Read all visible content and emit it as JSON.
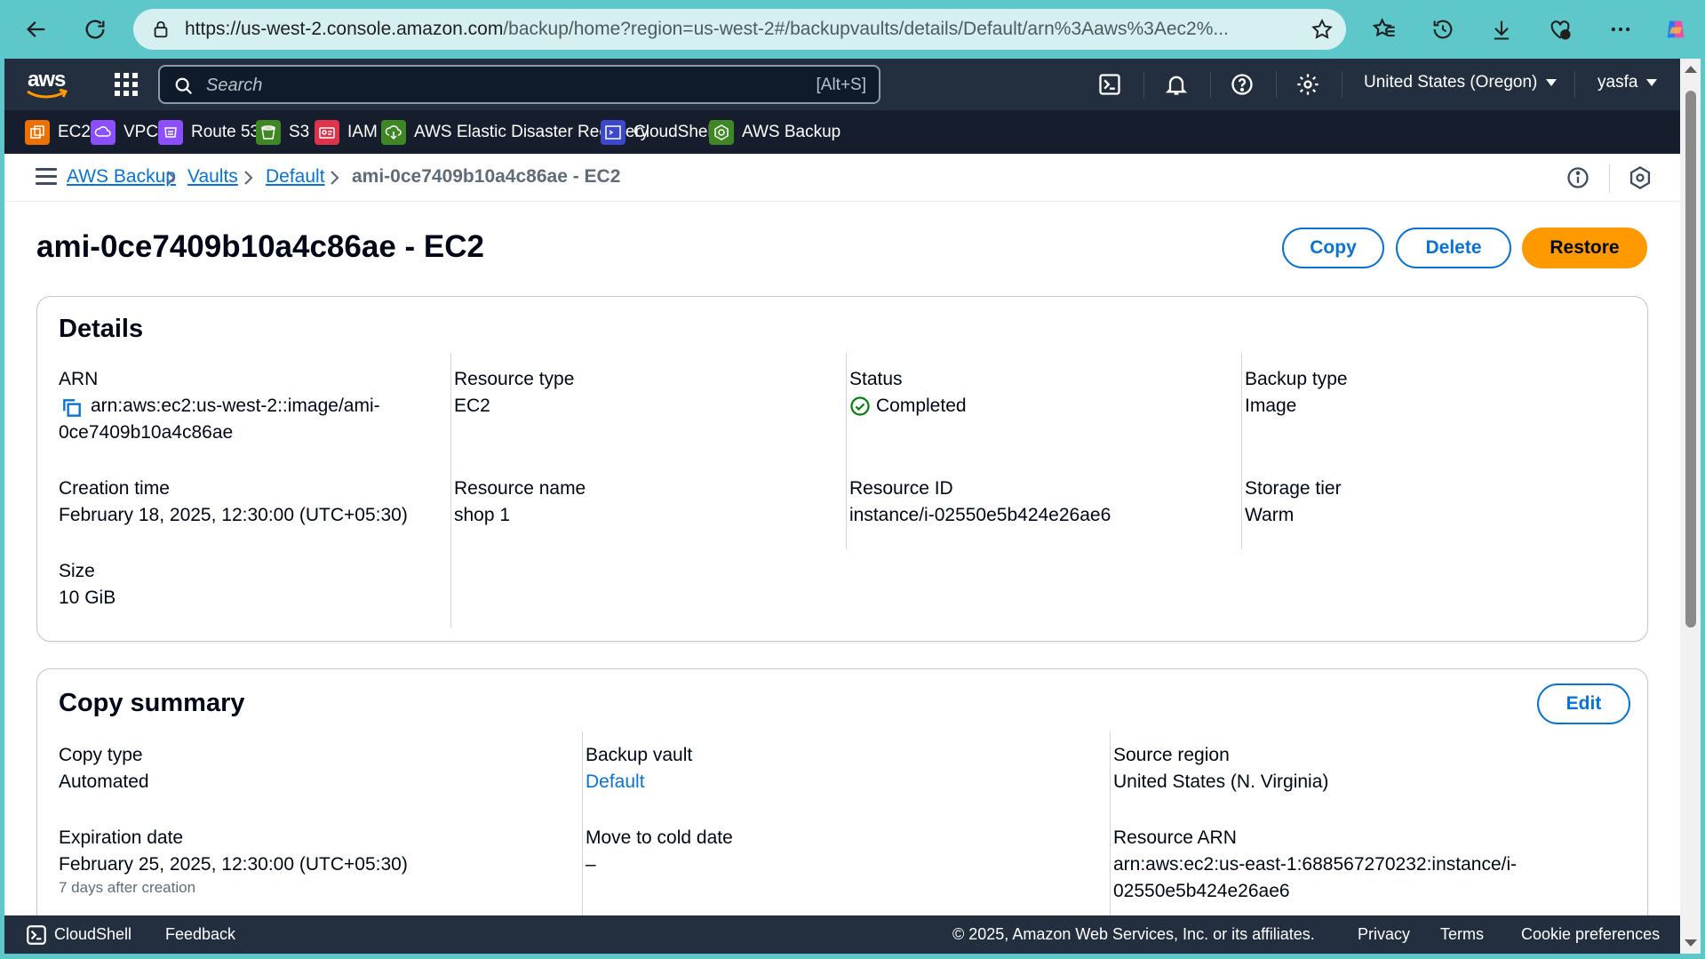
{
  "browser": {
    "url_host": "https://us-west-2.console.amazon.com",
    "url_path": "/backup/home?region=us-west-2#/backupvaults/details/Default/arn%3Aaws%3Aec2%..."
  },
  "topnav": {
    "search_placeholder": "Search",
    "search_shortcut": "[Alt+S]",
    "region": "United States (Oregon)",
    "user": "yasfa"
  },
  "favorites": [
    {
      "label": "EC2",
      "color": "#ed7100"
    },
    {
      "label": "VPC",
      "color": "#8c4fff"
    },
    {
      "label": "Route 53",
      "color": "#8c4fff"
    },
    {
      "label": "S3",
      "color": "#3f8624"
    },
    {
      "label": "IAM",
      "color": "#dd344c"
    },
    {
      "label": "AWS Elastic Disaster Recovery",
      "color": "#3f8624"
    },
    {
      "label": "CloudShell",
      "color": "#3b48cc"
    },
    {
      "label": "AWS Backup",
      "color": "#3f8624"
    }
  ],
  "breadcrumb": {
    "items": [
      "AWS Backup",
      "Vaults",
      "Default"
    ],
    "current": "ami-0ce7409b10a4c86ae - EC2"
  },
  "page": {
    "title": "ami-0ce7409b10a4c86ae - EC2",
    "copy_label": "Copy",
    "delete_label": "Delete",
    "restore_label": "Restore"
  },
  "details": {
    "title": "Details",
    "arn_label": "ARN",
    "arn_line1": "arn:aws:ec2:us-west-2::image/ami-",
    "arn_line2": "0ce7409b10a4c86ae",
    "creation_time_label": "Creation time",
    "creation_time": "February 18, 2025, 12:30:00 (UTC+05:30)",
    "size_label": "Size",
    "size": "10 GiB",
    "resource_type_label": "Resource type",
    "resource_type": "EC2",
    "resource_name_label": "Resource name",
    "resource_name": "shop 1",
    "status_label": "Status",
    "status": "Completed",
    "resource_id_label": "Resource ID",
    "resource_id": "instance/i-02550e5b424e26ae6",
    "backup_type_label": "Backup type",
    "backup_type": "Image",
    "storage_tier_label": "Storage tier",
    "storage_tier": "Warm"
  },
  "copy_summary": {
    "title": "Copy summary",
    "edit_label": "Edit",
    "copy_type_label": "Copy type",
    "copy_type": "Automated",
    "expiration_label": "Expiration date",
    "expiration": "February 25, 2025, 12:30:00 (UTC+05:30)",
    "expiration_sub": "7 days after creation",
    "backup_vault_label": "Backup vault",
    "backup_vault": "Default",
    "cold_date_label": "Move to cold date",
    "cold_date": "–",
    "source_region_label": "Source region",
    "source_region": "United States (N. Virginia)",
    "resource_arn_label": "Resource ARN",
    "resource_arn_line1": "arn:aws:ec2:us-east-1:688567270232:instance/i-",
    "resource_arn_line2": "02550e5b424e26ae6"
  },
  "footer": {
    "cloudshell": "CloudShell",
    "feedback": "Feedback",
    "copyright": "© 2025, Amazon Web Services, Inc. or its affiliates.",
    "privacy": "Privacy",
    "terms": "Terms",
    "cookie": "Cookie preferences"
  }
}
